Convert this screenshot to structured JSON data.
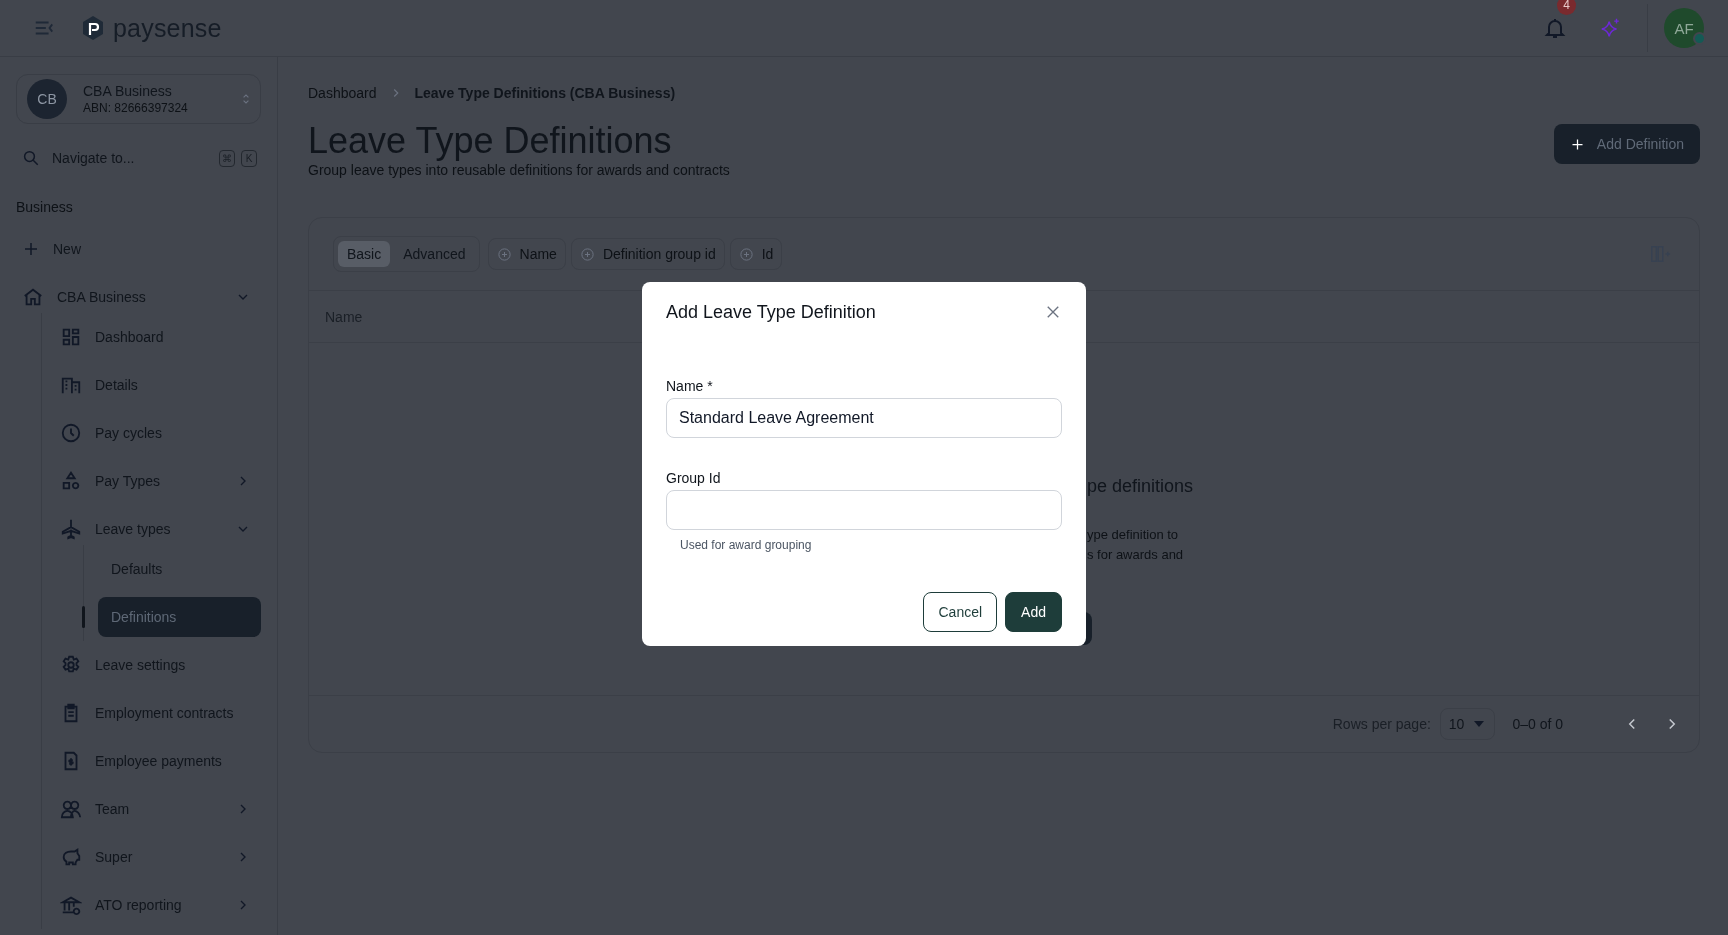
{
  "header": {
    "logo_text": "paysense",
    "notification_count": "4",
    "avatar_initials": "AF",
    "avatar_online": true
  },
  "sidebar": {
    "business": {
      "initials": "CB",
      "name": "CBA Business",
      "abn": "ABN: 82666397324"
    },
    "search": {
      "placeholder": "Navigate to...",
      "keys": [
        "⌘",
        "K"
      ]
    },
    "section_label": "Business",
    "new_label": "New",
    "group": {
      "label": "CBA Business",
      "expanded": true,
      "selected": false,
      "items": [
        {
          "label": "Dashboard",
          "selected": false
        },
        {
          "label": "Details",
          "selected": false
        },
        {
          "label": "Pay cycles",
          "selected": false
        },
        {
          "label": "Pay Types",
          "selected": false,
          "expanded": false
        },
        {
          "label": "Leave types",
          "selected": false,
          "expanded": true,
          "children": [
            {
              "label": "Defaults",
              "selected": false
            },
            {
              "label": "Definitions",
              "selected": true
            }
          ]
        },
        {
          "label": "Leave settings",
          "selected": false
        },
        {
          "label": "Employment contracts",
          "selected": false
        },
        {
          "label": "Employee payments",
          "selected": false
        },
        {
          "label": "Team",
          "selected": false,
          "expanded": false
        },
        {
          "label": "Super",
          "selected": false,
          "expanded": false
        },
        {
          "label": "ATO reporting",
          "selected": false,
          "expanded": false
        }
      ]
    }
  },
  "breadcrumb": [
    "Dashboard",
    "Leave Type Definitions (CBA Business)"
  ],
  "page": {
    "title": "Leave Type Definitions",
    "subtitle": "Group leave types into reusable definitions for awards and contracts",
    "primary_button": "Add Definition"
  },
  "filters": {
    "modes": [
      {
        "label": "Basic",
        "selected": true
      },
      {
        "label": "Advanced",
        "selected": false
      }
    ],
    "chips": [
      "Name",
      "Definition group id",
      "Id"
    ]
  },
  "table": {
    "columns": [
      "Name"
    ],
    "empty_state": {
      "heading": "pe definitions",
      "lines": [
        "ype definition to",
        "s for awards and"
      ]
    }
  },
  "pagination": {
    "rows_label": "Rows per page:",
    "rows_value": "10",
    "range": "0–0 of 0"
  },
  "dialog": {
    "title": "Add Leave Type Definition",
    "fields": [
      {
        "label": "Name *",
        "value": "Standard Leave Agreement"
      },
      {
        "label": "Group Id",
        "hint": "Used for award grouping"
      }
    ],
    "buttons": [
      {
        "label": "Cancel",
        "kind": "secondary"
      },
      {
        "label": "Add",
        "kind": "primary"
      }
    ]
  }
}
